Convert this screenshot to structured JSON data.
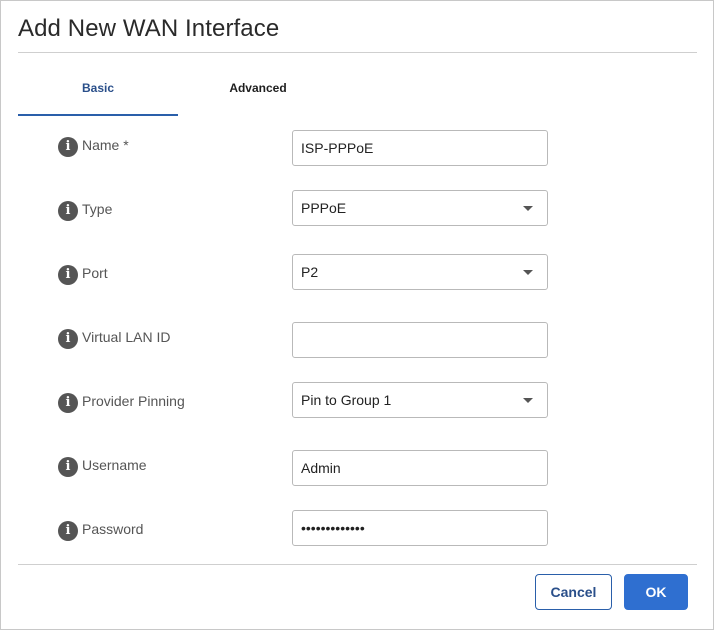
{
  "dialog": {
    "title": "Add New WAN Interface",
    "tabs": [
      {
        "label": "Basic",
        "active": true
      },
      {
        "label": "Advanced",
        "active": false
      }
    ],
    "fields": {
      "name": {
        "label": "Name *",
        "value": "ISP-PPPoE"
      },
      "type": {
        "label": "Type",
        "value": "PPPoE"
      },
      "port": {
        "label": "Port",
        "value": "P2"
      },
      "vlan": {
        "label": "Virtual LAN ID",
        "value": ""
      },
      "pinning": {
        "label": "Provider Pinning",
        "value": "Pin to Group 1"
      },
      "username": {
        "label": "Username",
        "value": "Admin"
      },
      "password": {
        "label": "Password",
        "value": "•••••••••••••"
      }
    },
    "buttons": {
      "cancel": "Cancel",
      "ok": "OK"
    },
    "info_icon_glyph": "i"
  },
  "colors": {
    "accent": "#2f6fd0",
    "tab_active_text": "#2a4f8a",
    "info_icon": "#555555"
  }
}
